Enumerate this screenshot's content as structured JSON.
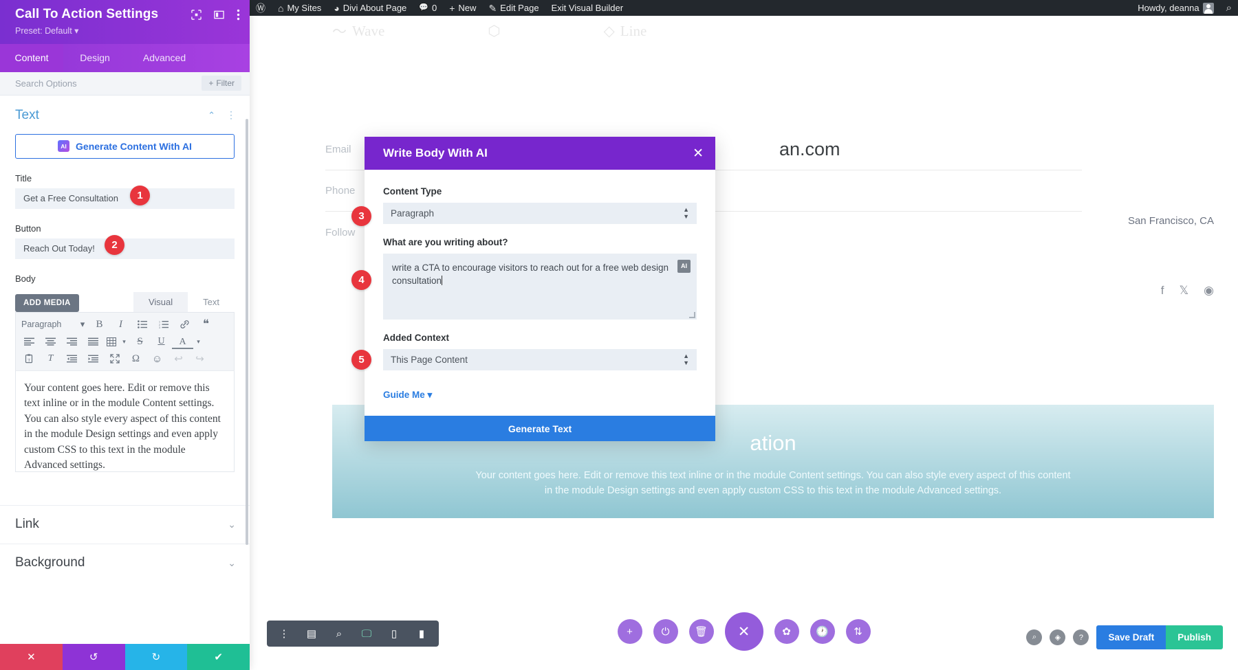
{
  "adminbar": {
    "items": [
      {
        "icon": "wordpress-logo-icon",
        "glyph": "Ⓦ",
        "label": ""
      },
      {
        "icon": "sites-icon",
        "glyph": "⌂",
        "label": "My Sites"
      },
      {
        "icon": "dashboard-icon",
        "glyph": "◕",
        "label": "Divi About Page"
      },
      {
        "icon": "comment-icon",
        "glyph": "💬",
        "label": "0"
      },
      {
        "icon": "plus-icon",
        "glyph": "+",
        "label": "New"
      },
      {
        "icon": "pencil-icon",
        "glyph": "✎",
        "label": "Edit Page"
      },
      {
        "icon": "",
        "glyph": "",
        "label": "Exit Visual Builder"
      }
    ],
    "howdy": "Howdy, deanna",
    "search_icon": "search-icon"
  },
  "panel": {
    "title": "Call To Action Settings",
    "preset": "Preset: Default ▾",
    "header_icons": [
      "target-icon",
      "layout-icon",
      "kebab-menu-icon"
    ],
    "tabs": [
      {
        "label": "Content",
        "active": true
      },
      {
        "label": "Design",
        "active": false
      },
      {
        "label": "Advanced",
        "active": false
      }
    ],
    "search_placeholder": "Search Options",
    "filter_label": "Filter",
    "section": {
      "title": "Text",
      "collapse_icon": "chevron-up-icon",
      "menu_icon": "kebab-menu-icon"
    },
    "ai_generate_label": "Generate Content With AI",
    "ai_badge_text": "AI",
    "fields": [
      {
        "label": "Title",
        "value": "Get a Free Consultation",
        "step": "1"
      },
      {
        "label": "Button",
        "value": "Reach Out Today!",
        "step": "2"
      }
    ],
    "body_label": "Body",
    "add_media_label": "ADD MEDIA",
    "editor_tabs": [
      {
        "label": "Visual",
        "active": true
      },
      {
        "label": "Text",
        "active": false
      }
    ],
    "toolbar_row1": [
      {
        "name": "paragraph-format-select",
        "glyph": "Paragraph",
        "wide": true
      },
      {
        "name": "format-dropdown-caret-icon",
        "glyph": "▾"
      },
      {
        "name": "bold-icon",
        "glyph": "B"
      },
      {
        "name": "italic-icon",
        "glyph": "I"
      },
      {
        "name": "bulleted-list-icon",
        "glyph": "☰"
      },
      {
        "name": "numbered-list-icon",
        "glyph": "≡"
      },
      {
        "name": "link-icon",
        "glyph": "🔗"
      },
      {
        "name": "blockquote-icon",
        "glyph": "❝"
      }
    ],
    "toolbar_row2": [
      {
        "name": "align-left-icon",
        "glyph": "≡"
      },
      {
        "name": "align-center-icon",
        "glyph": "≡"
      },
      {
        "name": "align-right-icon",
        "glyph": "≡"
      },
      {
        "name": "align-justify-icon",
        "glyph": "≡"
      },
      {
        "name": "table-icon",
        "glyph": "⊞"
      },
      {
        "name": "table-dropdown-caret-icon",
        "glyph": "▾"
      },
      {
        "name": "strikethrough-icon",
        "glyph": "S"
      },
      {
        "name": "underline-icon",
        "glyph": "U"
      },
      {
        "name": "text-color-icon",
        "glyph": "A"
      },
      {
        "name": "text-color-caret-icon",
        "glyph": "▾"
      }
    ],
    "toolbar_row3": [
      {
        "name": "paste-as-text-icon",
        "glyph": "📋"
      },
      {
        "name": "clear-formatting-icon",
        "glyph": "T"
      },
      {
        "name": "outdent-icon",
        "glyph": "⇤"
      },
      {
        "name": "indent-icon",
        "glyph": "⇥"
      },
      {
        "name": "fullscreen-icon",
        "glyph": "⤢"
      },
      {
        "name": "special-character-icon",
        "glyph": "Ω"
      },
      {
        "name": "emoji-icon",
        "glyph": "☺"
      },
      {
        "name": "undo-icon",
        "glyph": "↩"
      },
      {
        "name": "redo-icon",
        "glyph": "↪"
      }
    ],
    "body_content": "Your content goes here. Edit or remove this text inline or in the module Content settings. You can also style every aspect of this content in the module Design settings and even apply custom CSS to this text in the module Advanced settings.",
    "collapsed_sections": [
      {
        "label": "Link"
      },
      {
        "label": "Background"
      }
    ],
    "footer_buttons": [
      {
        "name": "discard-changes-button",
        "glyph": "✕"
      },
      {
        "name": "undo-button",
        "glyph": "↺"
      },
      {
        "name": "redo-button",
        "glyph": "↻"
      },
      {
        "name": "save-changes-button",
        "glyph": "✔"
      }
    ]
  },
  "canvas": {
    "ghost_logos": [
      "Wave",
      "Line"
    ],
    "contact_rows": [
      {
        "label": "Email",
        "value": "an.com"
      },
      {
        "label": "Phone",
        "value": ""
      },
      {
        "label": "Follow",
        "value": ""
      }
    ],
    "city": "San Francisco, CA",
    "social": [
      {
        "name": "facebook-icon",
        "glyph": "f"
      },
      {
        "name": "x-twitter-icon",
        "glyph": "𝕏"
      },
      {
        "name": "instagram-icon",
        "glyph": "◉"
      }
    ],
    "cta_title": "ation",
    "cta_body": "Your content goes here. Edit or remove this text inline or in the module Content settings. You can also style every aspect of this content in the module Design settings and even apply custom CSS to this text in the module Advanced settings."
  },
  "modal": {
    "title": "Write Body With AI",
    "close_icon": "close-icon",
    "content_type_label": "Content Type",
    "content_type_value": "Paragraph",
    "content_type_step": "3",
    "prompt_label": "What are you writing about?",
    "prompt_value": "write a CTA to encourage visitors to reach out for a free web design consultation",
    "prompt_badge": "AI",
    "prompt_step": "4",
    "context_label": "Added Context",
    "context_value": "This Page Content",
    "context_step": "5",
    "guide_me_label": "Guide Me",
    "guide_me_caret": "▾",
    "generate_label": "Generate Text"
  },
  "bottom": {
    "view_toolbar": [
      {
        "name": "kebab-menu-icon",
        "glyph": "⋮",
        "active": false
      },
      {
        "name": "wireframe-view-icon",
        "glyph": "▤",
        "active": false
      },
      {
        "name": "zoom-out-view-icon",
        "glyph": "⌕",
        "active": false
      },
      {
        "name": "desktop-view-icon",
        "glyph": "🖵",
        "active": true
      },
      {
        "name": "tablet-view-icon",
        "glyph": "▯",
        "active": false
      },
      {
        "name": "phone-view-icon",
        "glyph": "▮",
        "active": false
      }
    ],
    "round_toolbar": [
      {
        "name": "add-section-button",
        "glyph": "+",
        "big": false
      },
      {
        "name": "toggle-builder-button",
        "glyph": "⏻",
        "big": false
      },
      {
        "name": "trash-button",
        "glyph": "🗑",
        "big": false
      },
      {
        "name": "close-builder-button",
        "glyph": "✕",
        "big": true
      },
      {
        "name": "settings-button",
        "glyph": "✿",
        "big": false
      },
      {
        "name": "history-button",
        "glyph": "🕐",
        "big": false
      },
      {
        "name": "portability-button",
        "glyph": "⇅",
        "big": false
      }
    ],
    "right_circles": [
      {
        "name": "search-icon",
        "glyph": "⌕"
      },
      {
        "name": "layers-icon",
        "glyph": "◈"
      },
      {
        "name": "help-icon",
        "glyph": "?"
      }
    ],
    "save_draft_label": "Save Draft",
    "publish_label": "Publish"
  },
  "colors": {
    "panel_purple": "#8c2fd4",
    "modal_purple": "#7726cd",
    "step_red": "#e8353d",
    "accent_blue": "#2a7de1",
    "publish_green": "#2bc495"
  }
}
